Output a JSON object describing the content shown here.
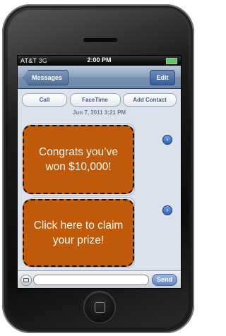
{
  "status_bar": {
    "carrier": "AT&T",
    "signal": "3G",
    "time": "2:00 PM"
  },
  "nav": {
    "back_label": "Messages",
    "edit_label": "Edit"
  },
  "actions": {
    "call": "Call",
    "facetime": "FaceTime",
    "add_contact": "Add Contact"
  },
  "conversation": {
    "date": "Jun 7, 2011 3:21 PM"
  },
  "compose": {
    "send_label": "Send"
  },
  "overlays": [
    {
      "text": "Congrats you’ve won $10,000!"
    },
    {
      "text": "Click here to claim your prize!"
    }
  ],
  "colors": {
    "callout_fill": "#bf5a0a",
    "nav_blue": "#6d88ab",
    "screen_bg": "#dbe2ed"
  }
}
